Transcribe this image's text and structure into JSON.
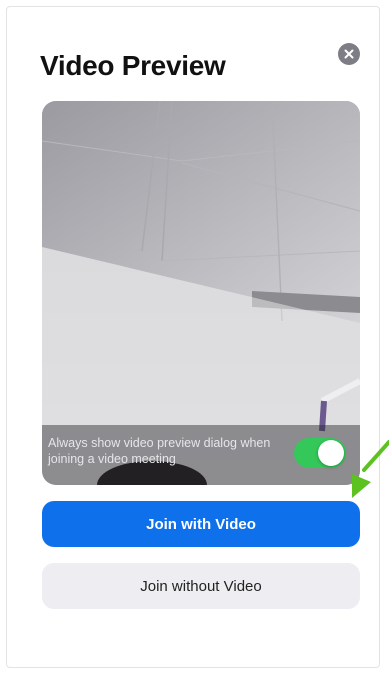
{
  "dialog": {
    "title": "Video Preview",
    "close_icon": "close-icon",
    "preview_toggle_label": "Always show video preview dialog when joining a video meeting",
    "preview_toggle_on": true,
    "join_with_video_label": "Join with Video",
    "join_without_video_label": "Join without Video"
  },
  "colors": {
    "primary_button": "#0e71eb",
    "toggle_on": "#34c759",
    "secondary_button": "#eeeef2",
    "annotation_arrow": "#5cc21f"
  },
  "annotation": {
    "arrow_icon": "arrow-icon"
  }
}
